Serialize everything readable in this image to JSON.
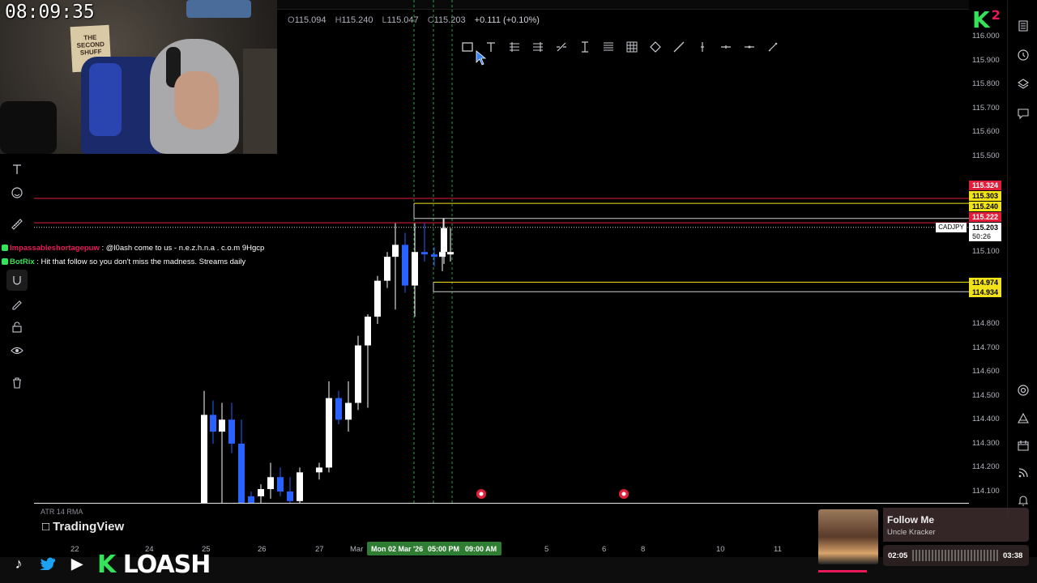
{
  "ohlc": {
    "o_key": "O",
    "o": "115.094",
    "h_key": "H",
    "h": "115.240",
    "l_key": "L",
    "l": "115.047",
    "c_key": "C",
    "c": "115.203",
    "chg": "+0.111 (+0.10%)"
  },
  "webcam": {
    "clock": "08:09:35",
    "poster": "THE SECOND SHUFF"
  },
  "chat": [
    {
      "user": "Impassableshortagepuw",
      "sep": " : ",
      "msg": "@l0ash come to us - n.e.z.h.n.a . c.o.m 9Hgcp"
    },
    {
      "user": "BotRix",
      "sep": " : ",
      "msg": "Hit that follow so you don't miss the madness. Streams daily"
    }
  ],
  "price_axis": {
    "ticks": [
      "116.000",
      "115.900",
      "115.800",
      "115.700",
      "115.600",
      "115.500",
      "115.100",
      "114.800",
      "114.700",
      "114.600",
      "114.500",
      "114.400",
      "114.300",
      "114.200",
      "114.100"
    ],
    "labels": [
      {
        "text": "115.324",
        "bg": "#e0203a",
        "fg": "#ffffff"
      },
      {
        "text": "115.303",
        "bg": "#f2e21a",
        "fg": "#000000"
      },
      {
        "text": "115.240",
        "bg": "#f2e21a",
        "fg": "#000000"
      },
      {
        "text": "115.222",
        "bg": "#e0203a",
        "fg": "#ffffff"
      },
      {
        "text": "115.203",
        "bg": "#ffffff",
        "fg": "#000000"
      },
      {
        "text": "50:26",
        "bg": "#ffffff",
        "fg": "#555555"
      },
      {
        "text": "114.974",
        "bg": "#f2e21a",
        "fg": "#000000"
      },
      {
        "text": "114.934",
        "bg": "#f2e21a",
        "fg": "#000000"
      }
    ],
    "symbol_tag": "CADJPY"
  },
  "chart_data": {
    "type": "candlestick",
    "symbol": "CADJPY",
    "ylim": [
      114.0,
      116.05
    ],
    "indicator": "ATR 14 RMA",
    "x_ticks": [
      "22",
      "24",
      "25",
      "26",
      "27",
      "Mar",
      "5",
      "6",
      "8",
      "10",
      "11"
    ],
    "crosshair_labels": [
      "Mon 02 Mar '26",
      "05:00 PM",
      "09:00 AM"
    ],
    "candles": [
      {
        "o": 114.05,
        "h": 114.52,
        "l": 114.0,
        "c": 114.42,
        "up": true
      },
      {
        "o": 114.42,
        "h": 114.48,
        "l": 114.3,
        "c": 114.35,
        "up": false
      },
      {
        "o": 114.35,
        "h": 114.47,
        "l": 114.0,
        "c": 114.4,
        "up": true
      },
      {
        "o": 114.4,
        "h": 114.47,
        "l": 114.26,
        "c": 114.3,
        "up": false
      },
      {
        "o": 114.3,
        "h": 114.4,
        "l": 114.0,
        "c": 114.05,
        "up": false
      },
      {
        "o": 114.05,
        "h": 114.1,
        "l": 114.0,
        "c": 114.08,
        "up": false
      },
      {
        "o": 114.08,
        "h": 114.13,
        "l": 114.04,
        "c": 114.11,
        "up": true
      },
      {
        "o": 114.11,
        "h": 114.22,
        "l": 114.07,
        "c": 114.16,
        "up": true
      },
      {
        "o": 114.16,
        "h": 114.2,
        "l": 114.08,
        "c": 114.1,
        "up": false
      },
      {
        "o": 114.1,
        "h": 114.16,
        "l": 114.0,
        "c": 114.06,
        "up": false
      },
      {
        "o": 114.06,
        "h": 114.2,
        "l": 114.0,
        "c": 114.18,
        "up": true
      },
      {
        "o": 114.18,
        "h": 114.22,
        "l": 114.15,
        "c": 114.2,
        "up": true
      },
      {
        "o": 114.2,
        "h": 114.56,
        "l": 114.18,
        "c": 114.49,
        "up": true
      },
      {
        "o": 114.49,
        "h": 114.52,
        "l": 114.38,
        "c": 114.4,
        "up": false
      },
      {
        "o": 114.4,
        "h": 114.56,
        "l": 114.35,
        "c": 114.47,
        "up": true
      },
      {
        "o": 114.47,
        "h": 114.75,
        "l": 114.44,
        "c": 114.71,
        "up": true
      },
      {
        "o": 114.71,
        "h": 114.84,
        "l": 114.45,
        "c": 114.83,
        "up": true
      },
      {
        "o": 114.83,
        "h": 115.0,
        "l": 114.8,
        "c": 114.98,
        "up": true
      },
      {
        "o": 114.98,
        "h": 115.1,
        "l": 114.95,
        "c": 115.08,
        "up": true
      },
      {
        "o": 115.08,
        "h": 115.22,
        "l": 114.86,
        "c": 115.13,
        "up": true
      },
      {
        "o": 115.13,
        "h": 115.18,
        "l": 114.93,
        "c": 114.96,
        "up": false
      },
      {
        "o": 114.96,
        "h": 115.22,
        "l": 114.83,
        "c": 115.1,
        "up": true
      },
      {
        "o": 115.1,
        "h": 115.22,
        "l": 115.06,
        "c": 115.09,
        "up": false
      },
      {
        "o": 115.09,
        "h": 115.12,
        "l": 115.04,
        "c": 115.08,
        "up": false
      },
      {
        "o": 115.08,
        "h": 115.14,
        "l": 115.02,
        "c": 115.1,
        "up": true
      },
      {
        "o": 115.09,
        "h": 115.2,
        "l": 115.06,
        "c": 115.1,
        "up": true
      },
      {
        "o": 115.1,
        "h": 115.24,
        "l": 115.05,
        "c": 115.2,
        "up": true
      }
    ],
    "hlines": [
      {
        "price": 115.324,
        "color": "#e0203a"
      },
      {
        "price": 115.303,
        "color": "#f2e21a"
      },
      {
        "price": 115.24,
        "color": "#cfcfcf"
      },
      {
        "price": 115.222,
        "color": "#e0203a"
      },
      {
        "price": 114.974,
        "color": "#f2e21a"
      },
      {
        "price": 114.934,
        "color": "#cfcfcf"
      }
    ],
    "vlines_color": "#2e9d4a"
  },
  "bottom": {
    "atr": "ATR 14 RMA",
    "tv_logo": "TradingView",
    "brand_k": "K",
    "brand_name": "LOASH"
  },
  "music": {
    "title": "Follow Me",
    "artist": "Uncle Kracker",
    "elapsed": "02:05",
    "total": "03:38",
    "progress": 0.57
  },
  "badge": {
    "letter": "K",
    "count": "2"
  },
  "icons": {
    "left": [
      "text-icon",
      "emoji-icon",
      "ruler-icon",
      "magnet-icon",
      "pencil-lock-icon",
      "lock-icon",
      "eye-icon",
      "trash-icon"
    ],
    "right": [
      "watchlist-icon",
      "alarm-icon",
      "layers-icon",
      "chat-icon",
      "target-icon",
      "triangle-icon",
      "calendar-icon",
      "feed-icon",
      "bell-icon"
    ]
  }
}
